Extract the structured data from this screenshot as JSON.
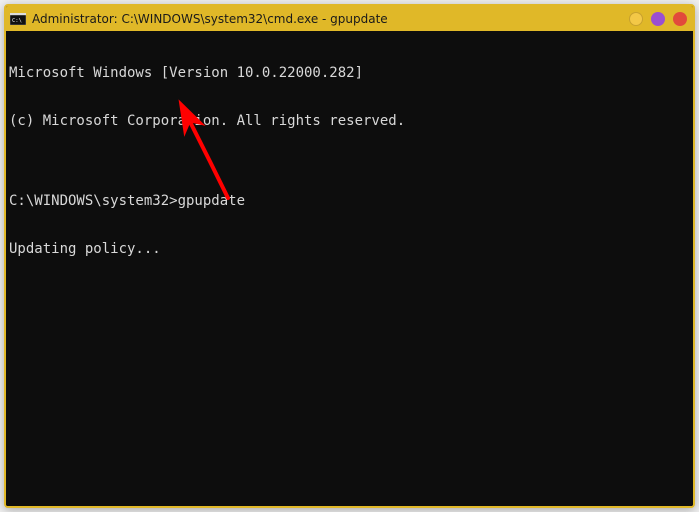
{
  "window": {
    "title": "Administrator: C:\\WINDOWS\\system32\\cmd.exe - gpupdate",
    "controls": {
      "minimize": "minimize-button",
      "maximize": "maximize-button",
      "close": "close-button"
    },
    "colors": {
      "titlebar": "#e0b828",
      "terminal_bg": "#0d0d0d",
      "terminal_fg": "#d8d8d8"
    }
  },
  "terminal": {
    "lines": [
      "Microsoft Windows [Version 10.0.22000.282]",
      "(c) Microsoft Corporation. All rights reserved.",
      "",
      "C:\\WINDOWS\\system32>gpupdate",
      "Updating policy...",
      ""
    ],
    "prompt": "C:\\WINDOWS\\system32>",
    "command": "gpupdate",
    "status": "Updating policy..."
  },
  "annotation": {
    "type": "arrow",
    "color": "#ff0000"
  }
}
